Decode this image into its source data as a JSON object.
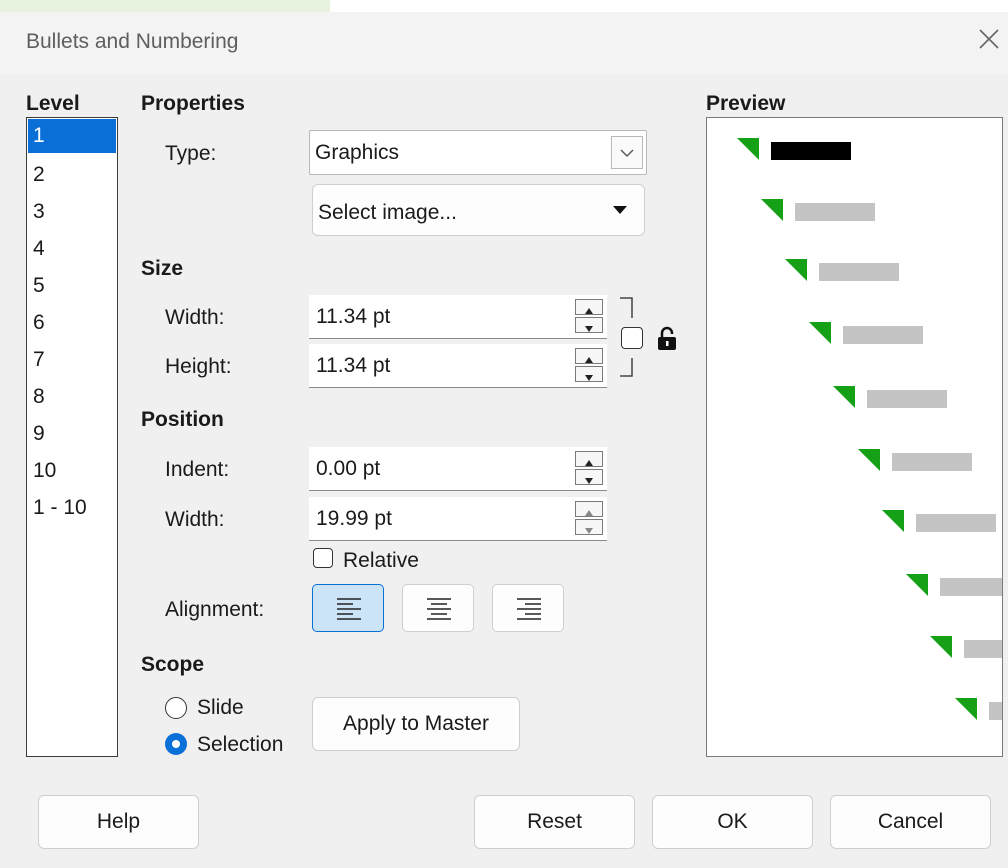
{
  "window": {
    "title": "Bullets and Numbering"
  },
  "levels": {
    "heading": "Level",
    "items": [
      "1",
      "2",
      "3",
      "4",
      "5",
      "6",
      "7",
      "8",
      "9",
      "10",
      "1 - 10"
    ],
    "selected": "1"
  },
  "properties": {
    "heading": "Properties",
    "type_label": "Type:",
    "type_value": "Graphics",
    "select_image_label": "Select image..."
  },
  "size": {
    "heading": "Size",
    "width_label": "Width:",
    "width_value": "11.34 pt",
    "height_label": "Height:",
    "height_value": "11.34 pt",
    "keep_ratio_checked": false,
    "lock_icon": "unlocked-padlock-icon"
  },
  "position": {
    "heading": "Position",
    "indent_label": "Indent:",
    "indent_value": "0.00 pt",
    "width_label": "Width:",
    "width_value": "19.99 pt",
    "relative_label": "Relative",
    "relative_checked": false,
    "alignment_label": "Alignment:",
    "alignment_selected": "left"
  },
  "scope": {
    "heading": "Scope",
    "slide_label": "Slide",
    "selection_label": "Selection",
    "selected": "Selection",
    "apply_master_label": "Apply to Master"
  },
  "preview": {
    "heading": "Preview",
    "bullet_color": "#16a016",
    "first_bar_color": "#000000",
    "bar_color": "#c4c4c4"
  },
  "footer": {
    "help_label": "Help",
    "reset_label": "Reset",
    "ok_label": "OK",
    "cancel_label": "Cancel"
  },
  "colors": {
    "accent": "#0a6fd6",
    "selected_align_bg": "#cce4f7"
  }
}
